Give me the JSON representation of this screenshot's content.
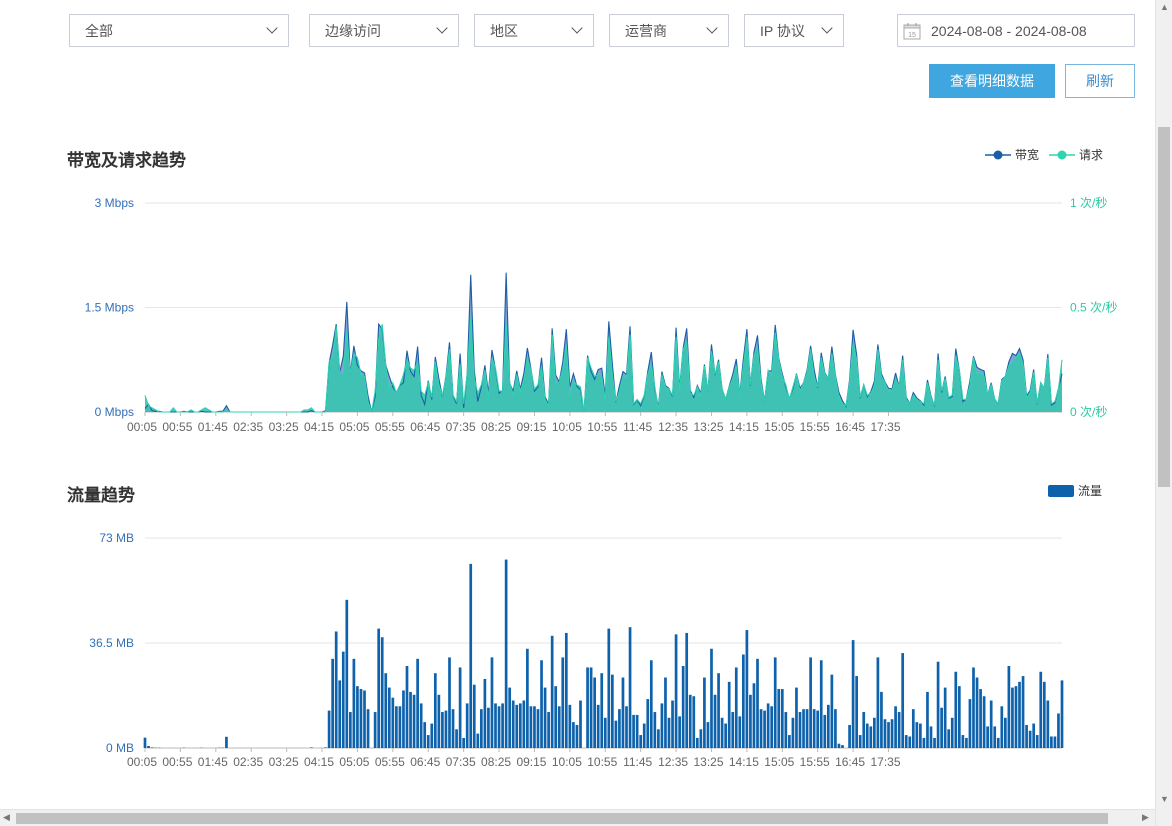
{
  "filters": [
    {
      "label": "全部"
    },
    {
      "label": "边缘访问"
    },
    {
      "label": "地区"
    },
    {
      "label": "运营商"
    },
    {
      "label": "IP 协议"
    }
  ],
  "date_range": {
    "value": "2024-08-08 - 2024-08-08",
    "calendar_day": "15"
  },
  "buttons": {
    "detail": "查看明细数据",
    "refresh": "刷新"
  },
  "colors": {
    "bandwidth": "#1b5da6",
    "bandwidth_fill": "#7b9fcf",
    "requests": "#2fd3b0",
    "requests_fill": "#37c4b0",
    "traffic": "#0e62ac",
    "left_axis": "#3270b6",
    "right_axis": "#2bc9a4"
  },
  "chart_data": [
    {
      "type": "area",
      "title": "带宽及请求趋势",
      "legend": {
        "placement": "top-right",
        "items": [
          "带宽",
          "请求"
        ]
      },
      "x_ticks": [
        "00:05",
        "00:55",
        "01:45",
        "02:35",
        "03:25",
        "04:15",
        "05:05",
        "05:55",
        "06:45",
        "07:35",
        "08:25",
        "09:15",
        "10:05",
        "10:55",
        "11:45",
        "12:35",
        "13:25",
        "14:15",
        "15:05",
        "15:55",
        "16:45",
        "17:35"
      ],
      "y_left_ticks": [
        "0 Mbps",
        "1.5 Mbps",
        "3 Mbps"
      ],
      "y_right_ticks": [
        "0 次/秒",
        "0.5 次/秒",
        "1 次/秒"
      ],
      "ylim_left": [
        0,
        3
      ],
      "ylim_right": [
        0,
        1
      ],
      "grid": true,
      "x_start_minutes": 5,
      "x_step_minutes": 5,
      "series": [
        {
          "name": "带宽",
          "axis": "left",
          "values": [
            0.05,
            0.11,
            0.02,
            0.01,
            0.01,
            0.0,
            0.0,
            0.0,
            0.0,
            0.0,
            0.0,
            0.01,
            0.0,
            0.0,
            0.0,
            0.0,
            0.01,
            0.0,
            0.0,
            0.0,
            0.0,
            0.01,
            0.01,
            0.09,
            0.0,
            0.0,
            0.0,
            0.0,
            0.0,
            0.0,
            0.0,
            0.0,
            0.0,
            0.0,
            0.0,
            0.0,
            0.0,
            0.0,
            0.0,
            0.0,
            0.0,
            0.0,
            0.0,
            0.0,
            0.0,
            0.0,
            0.0,
            0.02,
            0.0,
            0.0,
            0.0,
            0.02,
            0.7,
            0.96,
            1.26,
            0.57,
            0.8,
            1.58,
            0.54,
            0.95,
            0.67,
            0.59,
            0.56,
            0.23,
            0.0,
            0.22,
            1.26,
            1.19,
            0.67,
            0.51,
            0.36,
            0.28,
            0.38,
            0.42,
            0.88,
            0.58,
            0.51,
            0.94,
            0.24,
            0.11,
            0.45,
            0.18,
            0.79,
            0.48,
            0.22,
            0.51,
            1.0,
            0.23,
            0.12,
            0.84,
            0.06,
            0.55,
            1.97,
            0.6,
            0.15,
            0.36,
            0.67,
            0.27,
            0.89,
            0.61,
            0.27,
            0.31,
            2.0,
            0.41,
            0.3,
            0.59,
            0.33,
            0.55,
            0.92,
            0.62,
            0.3,
            0.36,
            0.78,
            0.22,
            0.11,
            1.2,
            0.53,
            0.43,
            0.72,
            1.19,
            0.36,
            0.55,
            0.37,
            0.32,
            0.0,
            0.81,
            0.58,
            0.47,
            0.61,
            0.63,
            0.23,
            1.3,
            0.69,
            0.14,
            0.38,
            0.58,
            0.54,
            1.23,
            0.11,
            0.17,
            0.09,
            0.23,
            0.58,
            0.86,
            0.33,
            0.07,
            0.58,
            0.38,
            0.34,
            0.22,
            1.21,
            0.34,
            0.92,
            1.2,
            0.31,
            0.21,
            0.38,
            0.27,
            0.68,
            0.3,
            0.97,
            0.53,
            0.75,
            0.33,
            0.18,
            0.37,
            0.54,
            0.76,
            0.25,
            0.76,
            1.19,
            0.38,
            0.86,
            1.1,
            0.47,
            0.15,
            0.59,
            0.59,
            1.25,
            0.77,
            0.55,
            0.36,
            0.19,
            0.33,
            0.55,
            0.34,
            0.42,
            0.6,
            0.95,
            0.61,
            0.35,
            0.85,
            0.56,
            0.48,
            0.94,
            0.53,
            0.28,
            0.16,
            0.08,
            0.46,
            1.18,
            0.82,
            0.2,
            0.39,
            0.22,
            0.29,
            0.44,
            0.97,
            0.55,
            0.43,
            0.34,
            0.33,
            0.56,
            0.36,
            0.81,
            0.21,
            0.12,
            0.28,
            0.2,
            0.16,
            0.1,
            0.46,
            0.23,
            0.08,
            0.84,
            0.28,
            0.51,
            0.2,
            0.22,
            0.91,
            0.6,
            0.15,
            0.19,
            0.45,
            0.8,
            0.64,
            0.61,
            0.59,
            0.24,
            0.42,
            0.18,
            0.12,
            0.47,
            0.51,
            0.72,
            0.84,
            0.81,
            0.91,
            0.75,
            0.23,
            0.31,
            0.61,
            0.11,
            0.42,
            0.34,
            0.83,
            0.1,
            0.13,
            0.34,
            0.55
          ]
        },
        {
          "name": "请求",
          "axis": "right",
          "values": [
            0.08,
            0.03,
            0.02,
            0.01,
            0.0,
            0.0,
            0.0,
            0.0,
            0.02,
            0.0,
            0.0,
            0.0,
            0.0,
            0.01,
            0.0,
            0.0,
            0.01,
            0.02,
            0.01,
            0.0,
            0.0,
            0.0,
            0.0,
            0.01,
            0.0,
            0.0,
            0.0,
            0.0,
            0.0,
            0.0,
            0.0,
            0.0,
            0.0,
            0.0,
            0.0,
            0.0,
            0.0,
            0.0,
            0.0,
            0.0,
            0.0,
            0.0,
            0.0,
            0.0,
            0.0,
            0.01,
            0.01,
            0.02,
            0.0,
            0.0,
            0.0,
            0.0,
            0.24,
            0.26,
            0.41,
            0.19,
            0.18,
            0.38,
            0.18,
            0.28,
            0.26,
            0.18,
            0.17,
            0.05,
            0.0,
            0.1,
            0.35,
            0.42,
            0.22,
            0.11,
            0.14,
            0.09,
            0.13,
            0.18,
            0.25,
            0.21,
            0.2,
            0.24,
            0.1,
            0.08,
            0.14,
            0.07,
            0.24,
            0.13,
            0.08,
            0.16,
            0.3,
            0.08,
            0.05,
            0.23,
            0.04,
            0.18,
            0.45,
            0.16,
            0.09,
            0.13,
            0.2,
            0.07,
            0.26,
            0.21,
            0.1,
            0.1,
            0.42,
            0.14,
            0.08,
            0.18,
            0.1,
            0.15,
            0.26,
            0.2,
            0.11,
            0.13,
            0.22,
            0.06,
            0.03,
            0.37,
            0.14,
            0.14,
            0.21,
            0.32,
            0.08,
            0.15,
            0.13,
            0.12,
            0.0,
            0.26,
            0.21,
            0.17,
            0.18,
            0.17,
            0.06,
            0.36,
            0.18,
            0.05,
            0.1,
            0.17,
            0.16,
            0.37,
            0.04,
            0.06,
            0.04,
            0.08,
            0.18,
            0.23,
            0.12,
            0.01,
            0.18,
            0.12,
            0.11,
            0.08,
            0.36,
            0.1,
            0.3,
            0.34,
            0.09,
            0.08,
            0.12,
            0.08,
            0.22,
            0.1,
            0.29,
            0.18,
            0.24,
            0.11,
            0.06,
            0.12,
            0.16,
            0.22,
            0.08,
            0.22,
            0.36,
            0.13,
            0.27,
            0.31,
            0.14,
            0.05,
            0.2,
            0.17,
            0.38,
            0.25,
            0.17,
            0.13,
            0.06,
            0.12,
            0.18,
            0.1,
            0.14,
            0.19,
            0.3,
            0.17,
            0.12,
            0.26,
            0.18,
            0.16,
            0.28,
            0.17,
            0.07,
            0.04,
            0.03,
            0.14,
            0.33,
            0.25,
            0.07,
            0.13,
            0.08,
            0.09,
            0.12,
            0.3,
            0.17,
            0.14,
            0.1,
            0.1,
            0.16,
            0.12,
            0.25,
            0.06,
            0.04,
            0.08,
            0.06,
            0.05,
            0.04,
            0.14,
            0.07,
            0.03,
            0.25,
            0.1,
            0.16,
            0.07,
            0.08,
            0.27,
            0.2,
            0.06,
            0.06,
            0.13,
            0.26,
            0.18,
            0.19,
            0.17,
            0.08,
            0.13,
            0.06,
            0.04,
            0.15,
            0.17,
            0.22,
            0.24,
            0.26,
            0.28,
            0.23,
            0.07,
            0.09,
            0.19,
            0.04,
            0.14,
            0.11,
            0.26,
            0.04,
            0.05,
            0.11,
            0.25
          ]
        }
      ]
    },
    {
      "type": "bar",
      "title": "流量趋势",
      "legend": {
        "placement": "top-right",
        "items": [
          "流量"
        ]
      },
      "x_ticks": [
        "00:05",
        "00:55",
        "01:45",
        "02:35",
        "03:25",
        "04:15",
        "05:05",
        "05:55",
        "06:45",
        "07:35",
        "08:25",
        "09:15",
        "10:05",
        "10:55",
        "11:45",
        "12:35",
        "13:25",
        "14:15",
        "15:05",
        "15:55",
        "16:45",
        "17:35"
      ],
      "y_ticks": [
        "0 MB",
        "36.5 MB",
        "73 MB"
      ],
      "ylim": [
        0,
        73
      ],
      "grid": true,
      "x_start_minutes": 5,
      "x_step_minutes": 5,
      "series": [
        {
          "name": "流量",
          "values": [
            3.6,
            0.7,
            0.2,
            0.1,
            0.1,
            0.0,
            0.0,
            0.0,
            0.0,
            0.0,
            0.0,
            0.1,
            0.0,
            0.0,
            0.0,
            0.0,
            0.1,
            0.0,
            0.0,
            0.0,
            0.0,
            0.1,
            0.1,
            3.9,
            0.0,
            0.0,
            0.0,
            0.0,
            0.0,
            0.0,
            0.0,
            0.0,
            0.0,
            0.0,
            0.0,
            0.0,
            0.0,
            0.0,
            0.0,
            0.0,
            0.0,
            0.0,
            0.0,
            0.0,
            0.0,
            0.0,
            0.0,
            0.2,
            0.0,
            0.0,
            0.0,
            0.2,
            13.0,
            31.0,
            40.5,
            23.5,
            33.5,
            51.5,
            12.5,
            31.0,
            21.5,
            20.5,
            20.0,
            13.5,
            0.0,
            12.5,
            41.5,
            38.5,
            26.0,
            21.0,
            17.5,
            14.5,
            14.5,
            20.0,
            28.5,
            19.5,
            18.5,
            31.0,
            15.5,
            9.0,
            4.5,
            8.5,
            26.0,
            18.5,
            12.5,
            13.0,
            31.5,
            13.5,
            6.5,
            28.0,
            3.5,
            15.5,
            64.0,
            22.0,
            5.0,
            13.5,
            24.0,
            14.0,
            31.5,
            15.5,
            14.5,
            15.5,
            65.5,
            21.0,
            16.5,
            15.0,
            15.5,
            16.5,
            34.5,
            14.5,
            14.5,
            13.5,
            30.5,
            21.0,
            12.5,
            39.0,
            21.5,
            14.5,
            31.5,
            40.0,
            15.0,
            9.0,
            8.0,
            16.5,
            0.0,
            28.0,
            28.0,
            24.5,
            15.0,
            26.0,
            10.5,
            41.5,
            25.5,
            9.5,
            13.5,
            24.5,
            14.5,
            42.0,
            11.5,
            11.5,
            4.5,
            8.5,
            17.0,
            30.5,
            12.5,
            6.5,
            15.5,
            24.5,
            10.5,
            16.5,
            39.5,
            11.0,
            28.5,
            40.0,
            18.5,
            18.0,
            3.5,
            6.5,
            24.5,
            9.0,
            34.5,
            18.5,
            26.0,
            10.5,
            8.5,
            23.0,
            12.5,
            28.0,
            11.0,
            32.5,
            41.0,
            18.5,
            22.5,
            31.0,
            13.5,
            13.0,
            15.5,
            14.5,
            31.5,
            20.5,
            20.5,
            12.5,
            4.5,
            10.5,
            21.0,
            12.5,
            13.5,
            13.5,
            31.5,
            13.5,
            13.0,
            30.5,
            11.5,
            15.0,
            25.5,
            13.5,
            1.5,
            1.0,
            0.0,
            8.0,
            37.5,
            25.0,
            4.5,
            12.5,
            8.5,
            7.5,
            10.5,
            31.5,
            19.5,
            10.0,
            9.0,
            10.0,
            14.5,
            12.5,
            33.0,
            4.5,
            4.0,
            13.5,
            9.0,
            8.5,
            3.5,
            19.5,
            7.5,
            3.5,
            30.0,
            14.0,
            21.0,
            6.5,
            10.5,
            26.5,
            21.5,
            4.5,
            3.5,
            17.0,
            28.0,
            24.5,
            20.5,
            18.0,
            7.5,
            16.5,
            7.5,
            3.5,
            14.5,
            10.5,
            28.5,
            21.0,
            21.5,
            23.0,
            25.0,
            8.0,
            6.0,
            8.5,
            4.5,
            26.5,
            23.0,
            16.5,
            4.0,
            4.0,
            12.0,
            23.5
          ]
        }
      ]
    }
  ]
}
